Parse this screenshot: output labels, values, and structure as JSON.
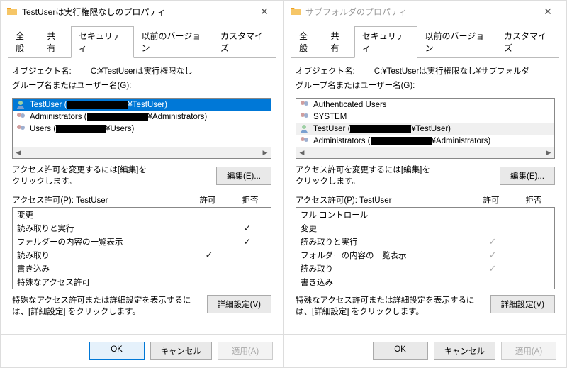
{
  "left": {
    "title": "TestUserは実行権限なしのプロパティ",
    "tabs": [
      "全般",
      "共有",
      "セキュリティ",
      "以前のバージョン",
      "カスタマイズ"
    ],
    "active_tab": 2,
    "object_label": "オブジェクト名:",
    "object_name": "C:¥TestUserは実行権限なし",
    "groups_label": "グループ名またはユーザー名(G):",
    "users": [
      {
        "name_pre": "TestUser (",
        "name_post": "¥TestUser)",
        "selected": true
      },
      {
        "name_pre": "Administrators (",
        "name_post": "¥Administrators)"
      },
      {
        "name_pre": "Users (",
        "name_post": "¥Users)"
      }
    ],
    "edit_text": "アクセス許可を変更するには[編集]を\nクリックします。",
    "edit_btn": "編集(E)...",
    "perm_label": "アクセス許可(P): TestUser",
    "col_allow": "許可",
    "col_deny": "拒否",
    "perms": [
      {
        "name": "変更",
        "allow": "",
        "deny": ""
      },
      {
        "name": "読み取りと実行",
        "allow": "",
        "deny": "✓"
      },
      {
        "name": "フォルダーの内容の一覧表示",
        "allow": "",
        "deny": "✓"
      },
      {
        "name": "読み取り",
        "allow": "✓",
        "deny": ""
      },
      {
        "name": "書き込み",
        "allow": "",
        "deny": ""
      },
      {
        "name": "特殊なアクセス許可",
        "allow": "",
        "deny": ""
      }
    ],
    "adv_text": "特殊なアクセス許可または詳細設定を表示するには、[詳細設定] をクリックします。",
    "adv_btn": "詳細設定(V)",
    "ok": "OK",
    "cancel": "キャンセル",
    "apply": "適用(A)"
  },
  "right": {
    "title": "サブフォルダのプロパティ",
    "tabs": [
      "全般",
      "共有",
      "セキュリティ",
      "以前のバージョン",
      "カスタマイズ"
    ],
    "active_tab": 2,
    "object_label": "オブジェクト名:",
    "object_name": "C:¥TestUserは実行権限なし¥サブフォルダ",
    "groups_label": "グループ名またはユーザー名(G):",
    "users": [
      {
        "name_pre": "Authenticated Users",
        "name_post": ""
      },
      {
        "name_pre": "SYSTEM",
        "name_post": ""
      },
      {
        "name_pre": "TestUser (",
        "name_post": "¥TestUser)",
        "sub": true
      },
      {
        "name_pre": "Administrators (",
        "name_post": "¥Administrators)"
      }
    ],
    "edit_text": "アクセス許可を変更するには[編集]を\nクリックします。",
    "edit_btn": "編集(E)...",
    "perm_label": "アクセス許可(P): TestUser",
    "col_allow": "許可",
    "col_deny": "拒否",
    "perms": [
      {
        "name": "フル コントロール",
        "allow": "",
        "deny": ""
      },
      {
        "name": "変更",
        "allow": "",
        "deny": ""
      },
      {
        "name": "読み取りと実行",
        "allow": "✓",
        "deny": ""
      },
      {
        "name": "フォルダーの内容の一覧表示",
        "allow": "✓",
        "deny": ""
      },
      {
        "name": "読み取り",
        "allow": "✓",
        "deny": ""
      },
      {
        "name": "書き込み",
        "allow": "",
        "deny": ""
      }
    ],
    "adv_text": "特殊なアクセス許可または詳細設定を表示するには、[詳細設定] をクリックします。",
    "adv_btn": "詳細設定(V)",
    "ok": "OK",
    "cancel": "キャンセル",
    "apply": "適用(A)"
  }
}
